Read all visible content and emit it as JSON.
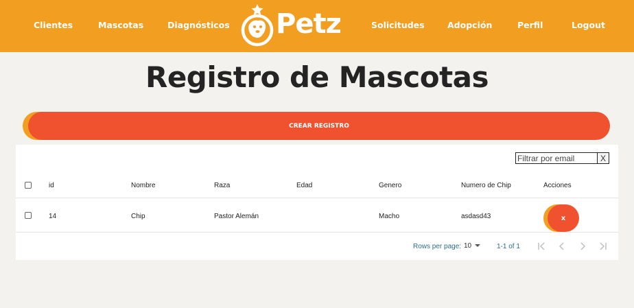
{
  "nav": {
    "links": [
      "Clientes",
      "Mascotas",
      "Diagnósticos",
      "Solicitudes",
      "Adopción",
      "Perfil",
      "Logout"
    ],
    "logo_text": "Petz"
  },
  "page": {
    "title": "Registro de Mascotas",
    "create_button": "CREAR REGISTRO"
  },
  "filter": {
    "placeholder": "Filtrar por email",
    "clear_label": "X"
  },
  "table": {
    "columns": [
      "id",
      "Nombre",
      "Raza",
      "Edad",
      "Genero",
      "Numero de Chip",
      "Acciones"
    ],
    "rows": [
      {
        "id": "14",
        "nombre": "Chip",
        "raza": "Pastor Alemán",
        "edad": "",
        "genero": "Macho",
        "chip": "asdasd43",
        "delete_label": "x"
      }
    ]
  },
  "pagination": {
    "rows_per_page_label": "Rows per page:",
    "rows_per_page_value": "10",
    "range": "1-1 of 1"
  },
  "colors": {
    "navbar": "#f29e20",
    "accent": "#f0522f",
    "background": "#f3f2ee"
  }
}
